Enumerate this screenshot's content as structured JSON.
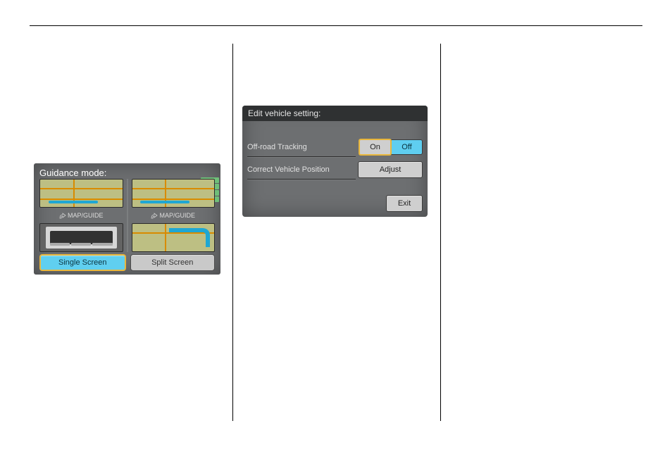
{
  "guidance_screen": {
    "title": "Guidance mode:",
    "map_caption": "MAP/GUIDE",
    "buttons": {
      "single": "Single Screen",
      "split": "Split Screen"
    }
  },
  "vehicle_screen": {
    "title": "Edit vehicle setting:",
    "rows": {
      "offroad": {
        "label": "Off-road Tracking",
        "on": "On",
        "off": "Off"
      },
      "correct": {
        "label": "Correct Vehicle Position",
        "button": "Adjust"
      }
    },
    "exit": "Exit"
  }
}
